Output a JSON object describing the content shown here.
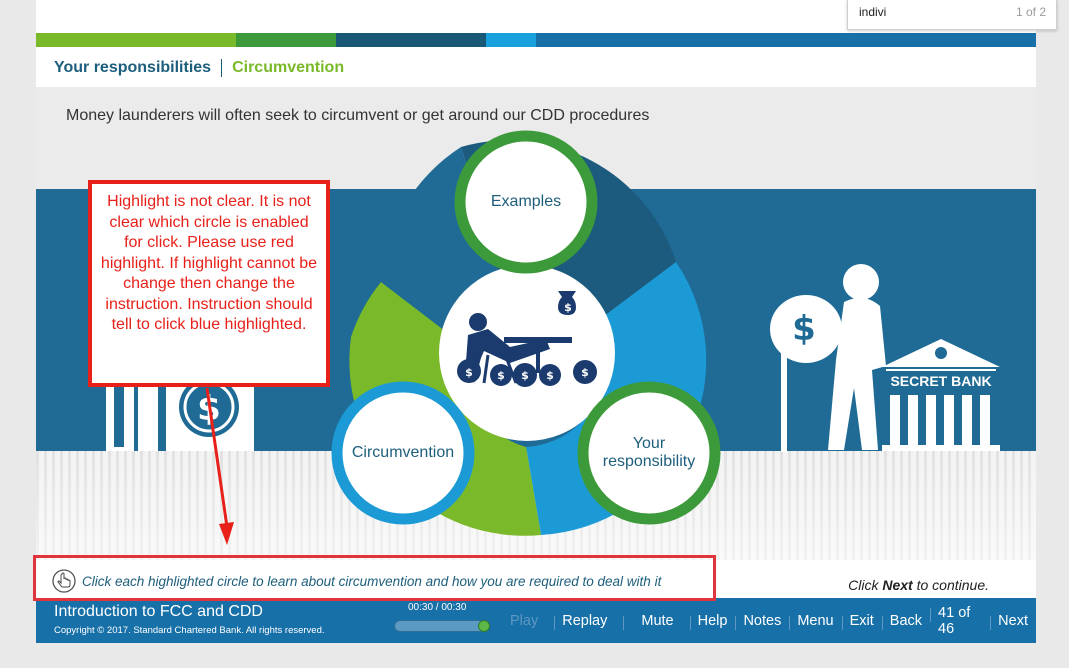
{
  "find_bar": {
    "query": "indivi",
    "count": "1 of 2"
  },
  "breadcrumb": {
    "section": "Your responsibilities",
    "topic": "Circumvention"
  },
  "slide": {
    "intro": "Money launderers will often seek to circumvent or get around our CDD procedures",
    "circles": {
      "examples": "Examples",
      "circumvention": "Circumvention",
      "your_responsibility": "Your responsibility"
    },
    "bank_sign": "SECRET BANK"
  },
  "annotation": {
    "text": "Highlight is not clear. It is not clear which circle is enabled for click. Please use red highlight. If highlight cannot be change then change the instruction. Instruction should tell to click blue highlighted."
  },
  "instruction": {
    "text": "Click each highlighted circle to learn about circumvention and how you are required to deal with it",
    "next_hint_pre": "Click ",
    "next_hint_bold": "Next",
    "next_hint_post": " to continue."
  },
  "footer": {
    "course_title": "Introduction to FCC and CDD",
    "copyright": "Copyright © 2017. Standard Chartered Bank. All rights reserved.",
    "timecode": "00:30 / 00:30",
    "progress": 1.0,
    "nav": {
      "play": "Play",
      "replay": "Replay",
      "mute": "Mute",
      "help": "Help",
      "notes": "Notes",
      "menu": "Menu",
      "exit": "Exit",
      "back": "Back",
      "page": "41 of 46",
      "next": "Next"
    }
  },
  "colors": {
    "brand_blue": "#1770a8",
    "brand_green": "#7ab929",
    "annotation_red": "#e8201a"
  }
}
